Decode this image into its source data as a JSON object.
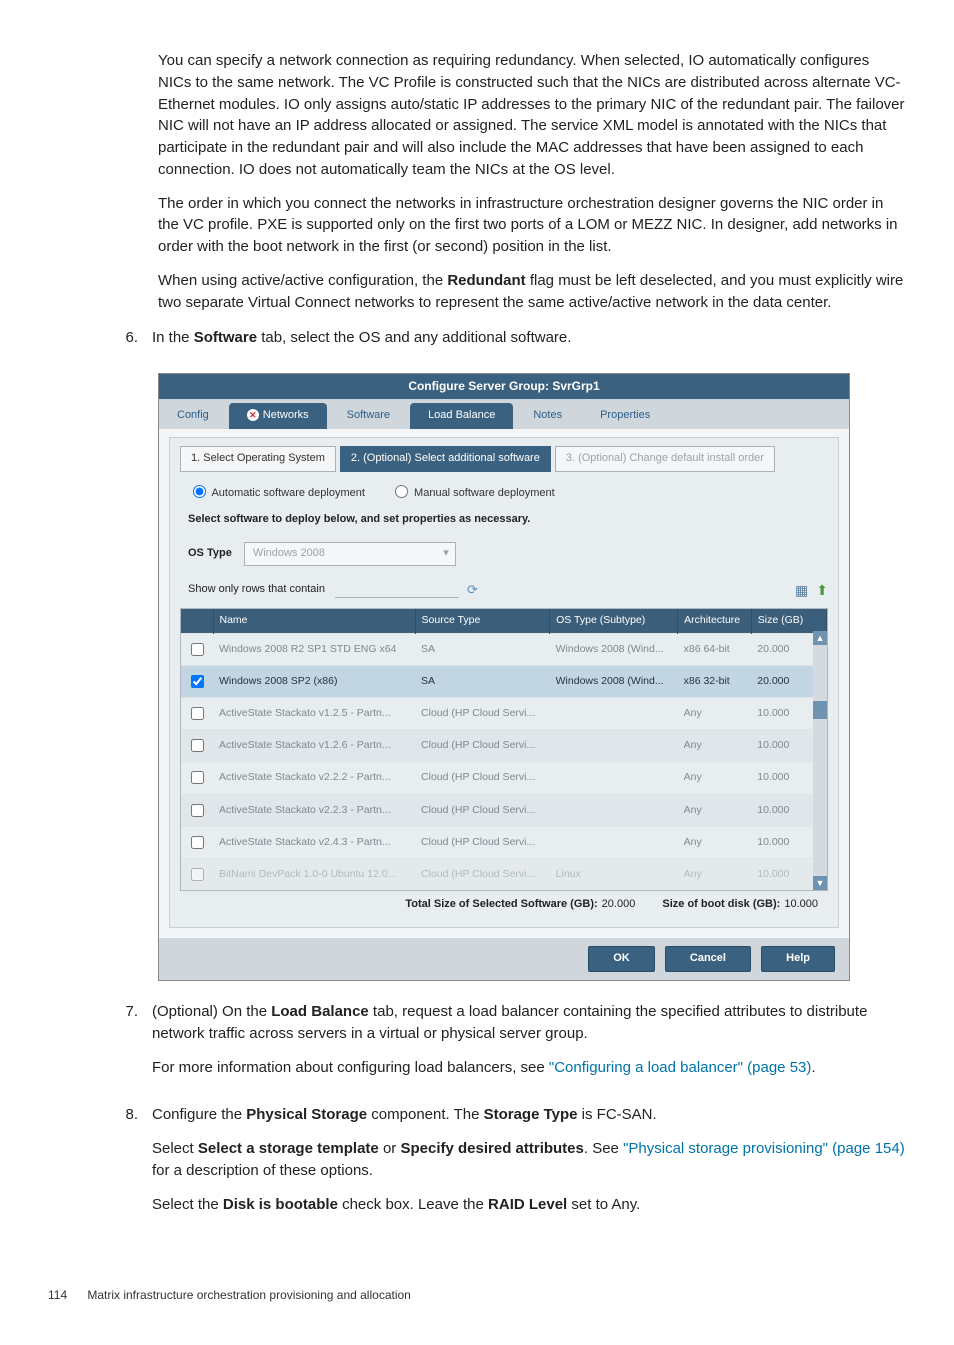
{
  "paragraphs": {
    "p1": "You can specify a network connection as requiring redundancy. When selected, IO automatically configures NICs to the same network. The VC Profile is constructed such that the NICs are distributed across alternate VC-Ethernet modules. IO only assigns auto/static IP addresses to the primary NIC of the redundant pair. The failover NIC will not have an IP address allocated or assigned. The service XML model is annotated with the NICs that participate in the redundant pair and will also include the MAC addresses that have been assigned to each connection. IO does not automatically team the NICs at the OS level.",
    "p2": "The order in which you connect the networks in infrastructure orchestration designer governs the NIC order in the VC profile. PXE is supported only on the first two ports of a LOM or MEZZ NIC. In designer, add networks in order with the boot network in the first (or second) position in the list.",
    "p3_pre": "When using active/active configuration, the ",
    "p3_b": "Redundant",
    "p3_post": " flag must be left deselected, and you must explicitly wire two separate Virtual Connect networks to represent the same active/active network in the data center."
  },
  "step6": {
    "num": "6.",
    "pre": "In the ",
    "b": "Software",
    "post": " tab, select the OS and any additional software."
  },
  "dialog": {
    "title": "Configure Server Group: SvrGrp1",
    "tabs": {
      "config": "Config",
      "networks": "Networks",
      "software": "Software",
      "load_balance": "Load Balance",
      "notes": "Notes",
      "properties": "Properties"
    },
    "steptabs": {
      "s1": "1. Select Operating System",
      "s2": "2. (Optional) Select additional software",
      "s3": "3. (Optional) Change default install order"
    },
    "radios": {
      "auto": "Automatic software deployment",
      "manual": "Manual software deployment"
    },
    "instr": "Select software to deploy below, and set properties as necessary.",
    "ostype": {
      "label": "OS Type",
      "value": "Windows 2008"
    },
    "filter": {
      "label": "Show only rows that contain"
    },
    "table": {
      "headers": {
        "name": "Name",
        "source": "Source Type",
        "ostype": "OS Type (Subtype)",
        "arch": "Architecture",
        "size": "Size (GB)"
      },
      "rows": [
        {
          "name": "Windows 2008 R2 SP1 STD ENG x64",
          "source": "SA",
          "ostype": "Windows 2008 (Wind...",
          "arch": "x86 64-bit",
          "size": "20.000"
        },
        {
          "name": "Windows 2008 SP2 (x86)",
          "source": "SA",
          "ostype": "Windows 2008 (Wind...",
          "arch": "x86 32-bit",
          "size": "20.000"
        },
        {
          "name": "ActiveState Stackato v1.2.5 - Partn...",
          "source": "Cloud (HP Cloud Servi...",
          "ostype": "",
          "arch": "Any",
          "size": "10.000"
        },
        {
          "name": "ActiveState Stackato v1.2.6 - Partn...",
          "source": "Cloud (HP Cloud Servi...",
          "ostype": "",
          "arch": "Any",
          "size": "10.000"
        },
        {
          "name": "ActiveState Stackato v2.2.2 - Partn...",
          "source": "Cloud (HP Cloud Servi...",
          "ostype": "",
          "arch": "Any",
          "size": "10.000"
        },
        {
          "name": "ActiveState Stackato v2.2.3 - Partn...",
          "source": "Cloud (HP Cloud Servi...",
          "ostype": "",
          "arch": "Any",
          "size": "10.000"
        },
        {
          "name": "ActiveState Stackato v2.4.3 - Partn...",
          "source": "Cloud (HP Cloud Servi...",
          "ostype": "",
          "arch": "Any",
          "size": "10.000"
        },
        {
          "name": "BitNami DevPack 1.0-0 Ubuntu 12.0...",
          "source": "Cloud (HP Cloud Servi...",
          "ostype": "Linux",
          "arch": "Any",
          "size": "10.000"
        }
      ]
    },
    "totals": {
      "sel_lbl": "Total Size of Selected Software (GB):",
      "sel_val": "20.000",
      "boot_lbl": "Size of boot disk (GB):",
      "boot_val": "10.000"
    },
    "buttons": {
      "ok": "OK",
      "cancel": "Cancel",
      "help": "Help"
    }
  },
  "step7": {
    "num": "7.",
    "p1_pre": "(Optional) On the ",
    "p1_b": "Load Balance",
    "p1_post": " tab, request a load balancer containing the specified attributes to distribute network traffic across servers in a virtual or physical server group.",
    "p2_pre": "For more information about configuring load balancers, see ",
    "p2_link": "\"Configuring a load balancer\" (page 53)",
    "p2_post": "."
  },
  "step8": {
    "num": "8.",
    "p1_a": "Configure the ",
    "p1_b": "Physical Storage",
    "p1_c": " component. The ",
    "p1_d": "Storage Type",
    "p1_e": " is FC-SAN.",
    "p2_a": "Select ",
    "p2_b": "Select a storage template",
    "p2_c": " or ",
    "p2_d": "Specify desired attributes",
    "p2_e": ". See ",
    "p2_link": "\"Physical storage provisioning\" (page 154)",
    "p2_f": " for a description of these options.",
    "p3_a": "Select the ",
    "p3_b": "Disk is bootable",
    "p3_c": " check box. Leave the ",
    "p3_d": "RAID Level",
    "p3_e": " set to Any."
  },
  "footer": {
    "page": "114",
    "title": "Matrix infrastructure orchestration provisioning and allocation"
  }
}
